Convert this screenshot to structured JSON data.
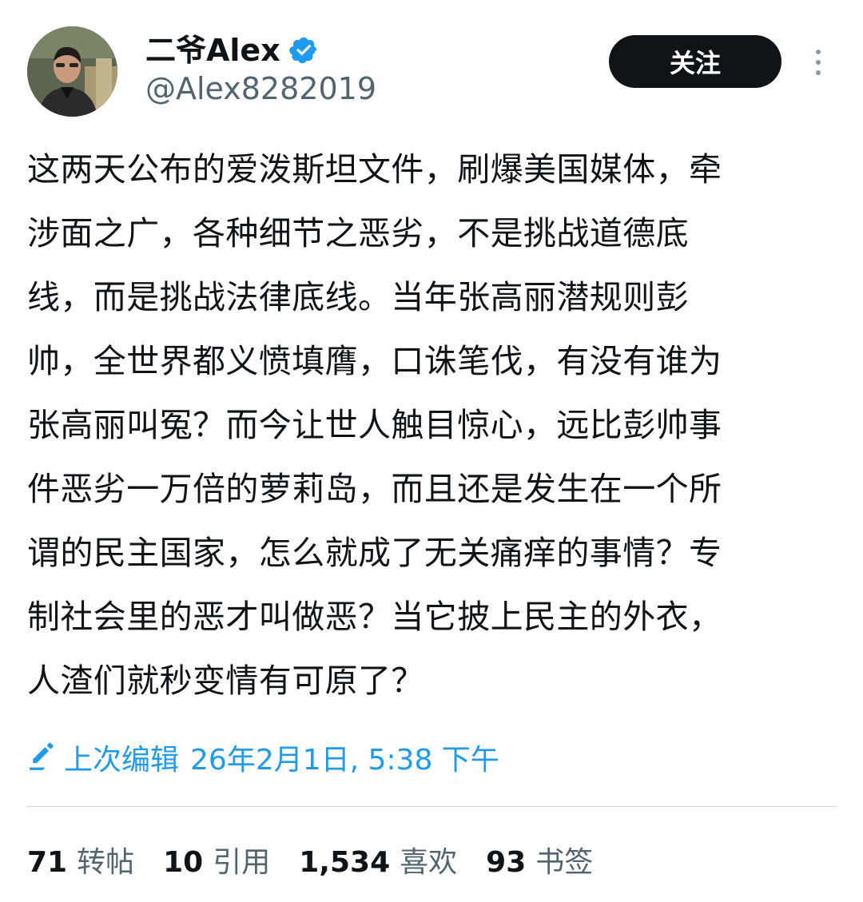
{
  "user": {
    "display_name": "二爷Alex",
    "handle": "@Alex8282019",
    "verified": true
  },
  "actions": {
    "follow_label": "关注"
  },
  "tweet": {
    "lines": [
      "这两天公布的爱泼斯坦文件，刷爆美国媒体，牵",
      "涉面之广，各种细节之恶劣，不是挑战道德底",
      "线，而是挑战法律底线。当年张高丽潜规则彭",
      "帅，全世界都义愤填膺，口诛笔伐，有没有谁为",
      "张高丽叫冤？而今让世人触目惊心，远比彭帅事",
      "件恶劣一万倍的萝莉岛，而且还是发生在一个所",
      "谓的民主国家，怎么就成了无关痛痒的事情？专",
      "制社会里的恶才叫做恶？当它披上民主的外衣，",
      "人渣们就秒变情有可原了？"
    ]
  },
  "edited": {
    "label": "上次编辑",
    "timestamp": "26年2月1日, 5:38 下午"
  },
  "stats": [
    {
      "count": "71",
      "label": "转帖"
    },
    {
      "count": "10",
      "label": "引用"
    },
    {
      "count": "1,534",
      "label": "喜欢"
    },
    {
      "count": "93",
      "label": "书签"
    }
  ],
  "colors": {
    "accent": "#1d9bf0",
    "text_primary": "#0f1419",
    "text_secondary": "#536471",
    "follow_button_bg": "#0f1419",
    "divider": "#cfd9de"
  },
  "icons": {
    "verified": "verified-badge-icon",
    "more": "more-vertical-icon",
    "edit": "pencil-icon"
  }
}
